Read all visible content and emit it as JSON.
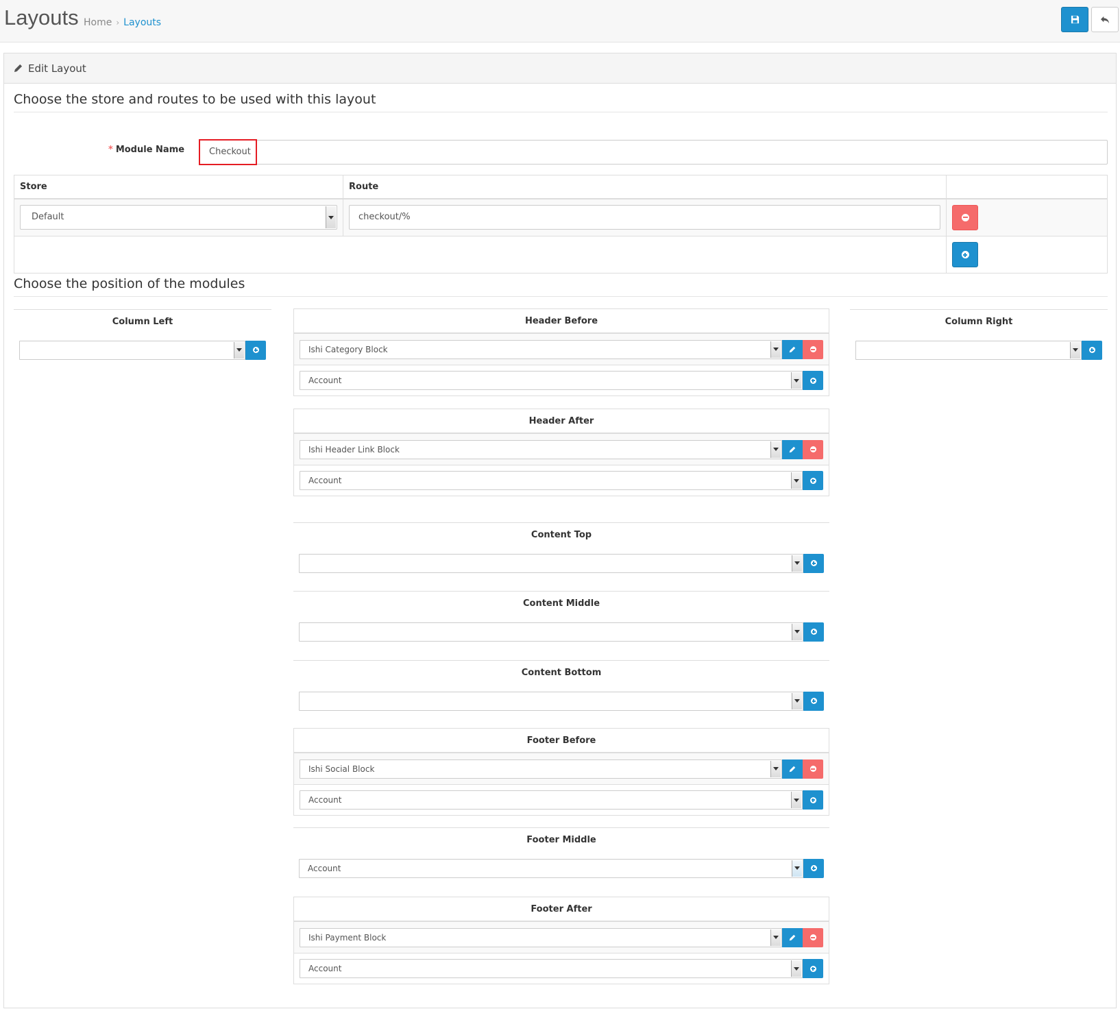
{
  "header": {
    "title": "Layouts",
    "breadcrumb": [
      {
        "label": "Home",
        "active": false
      },
      {
        "label": "Layouts",
        "active": true
      }
    ],
    "save_icon": "save-icon",
    "back_icon": "reply-icon"
  },
  "panel": {
    "heading": "Edit Layout",
    "section_store_title": "Choose the store and routes to be used with this layout",
    "module_name_label": "Module Name",
    "module_name_value": "Checkout",
    "routes_table": {
      "headers": [
        "Store",
        "Route",
        ""
      ],
      "rows": [
        {
          "store": "Default",
          "route": "checkout/%"
        }
      ]
    },
    "section_modules_title": "Choose the position of the modules"
  },
  "positions": {
    "column_left": {
      "title": "Column Left",
      "modules": [],
      "empty_select": ""
    },
    "column_right": {
      "title": "Column Right",
      "modules": [],
      "empty_select": ""
    },
    "header_before": {
      "title": "Header Before",
      "modules": [
        "Ishi Category Block"
      ],
      "add_select": "Account"
    },
    "header_after": {
      "title": "Header After",
      "modules": [
        "Ishi Header Link Block"
      ],
      "add_select": "Account"
    },
    "content_top": {
      "title": "Content Top",
      "modules": [],
      "add_select": ""
    },
    "content_middle": {
      "title": "Content Middle",
      "modules": [],
      "add_select": ""
    },
    "content_bottom": {
      "title": "Content Bottom",
      "modules": [],
      "add_select": ""
    },
    "footer_before": {
      "title": "Footer Before",
      "modules": [
        "Ishi Social Block"
      ],
      "add_select": "Account"
    },
    "footer_middle": {
      "title": "Footer Middle",
      "modules": [],
      "add_select": "Account"
    },
    "footer_after": {
      "title": "Footer After",
      "modules": [
        "Ishi Payment Block"
      ],
      "add_select": "Account"
    }
  },
  "colors": {
    "primary": "#1e91cf",
    "danger": "#f56b6b",
    "highlight": "#e51c23"
  }
}
